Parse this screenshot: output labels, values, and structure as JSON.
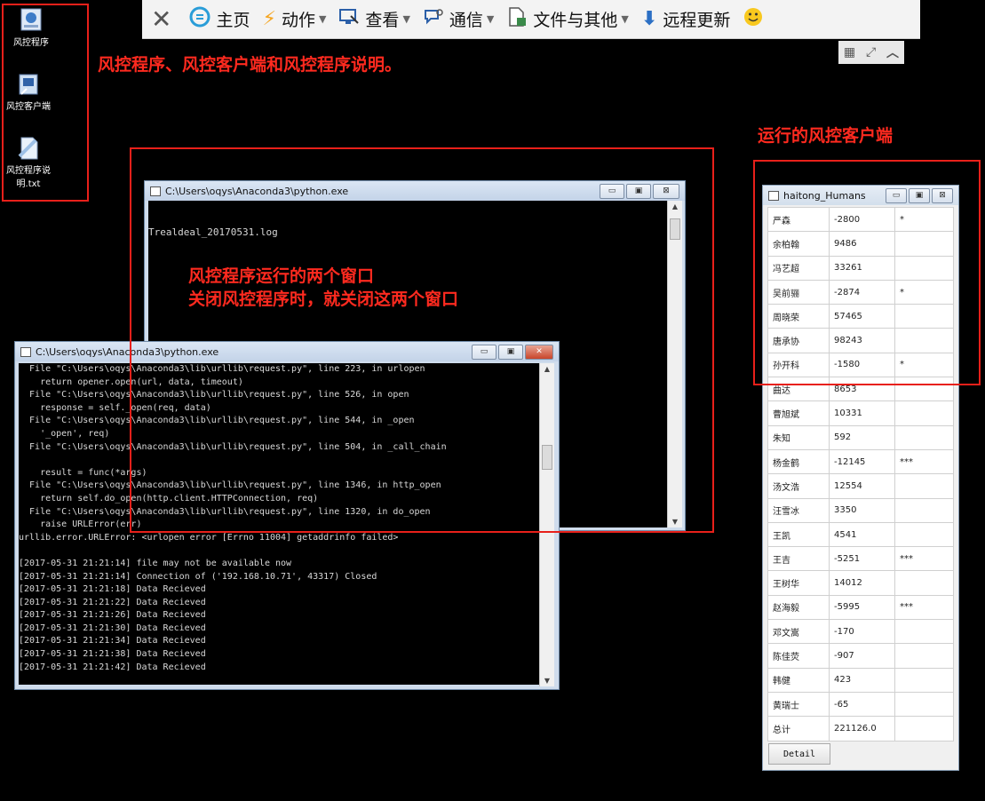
{
  "toolbar": {
    "items": [
      {
        "label": "",
        "icon": "close-icon"
      },
      {
        "label": "主页",
        "icon": "home-icon"
      },
      {
        "label": "动作",
        "icon": "lightning-icon",
        "dropdown": true
      },
      {
        "label": "查看",
        "icon": "monitor-icon",
        "dropdown": true
      },
      {
        "label": "通信",
        "icon": "chat-icon",
        "dropdown": true
      },
      {
        "label": "文件与其他",
        "icon": "file-icon",
        "dropdown": true
      },
      {
        "label": "远程更新",
        "icon": "download-icon"
      },
      {
        "label": "",
        "icon": "smiley-icon"
      }
    ]
  },
  "desktop": {
    "icons": [
      {
        "label": "风控程序",
        "icon": "program-icon"
      },
      {
        "label": "风控客户端",
        "icon": "shortcut-icon"
      },
      {
        "label": "风控程序说明.txt",
        "label_line1": "风控程序说",
        "label_line2": "明.txt",
        "icon": "text-file-icon"
      }
    ]
  },
  "annotations": {
    "desktop_note": "风控程序、风控客户端和风控程序说明。",
    "client_note": "运行的风控客户端",
    "windows_note_line1": "风控程序运行的两个窗口",
    "windows_note_line2": "关闭风控程序时，就关闭这两个窗口"
  },
  "window_back": {
    "title": "C:\\Users\\oqys\\Anaconda3\\python.exe",
    "lines": [
      "Trealdeal_20170531.log"
    ]
  },
  "window_front": {
    "title": "C:\\Users\\oqys\\Anaconda3\\python.exe",
    "text": "  File \"C:\\Users\\oqys\\Anaconda3\\lib\\urllib\\request.py\", line 223, in urlopen\n    return opener.open(url, data, timeout)\n  File \"C:\\Users\\oqys\\Anaconda3\\lib\\urllib\\request.py\", line 526, in open\n    response = self._open(req, data)\n  File \"C:\\Users\\oqys\\Anaconda3\\lib\\urllib\\request.py\", line 544, in _open\n    '_open', req)\n  File \"C:\\Users\\oqys\\Anaconda3\\lib\\urllib\\request.py\", line 504, in _call_chain\n\n    result = func(*args)\n  File \"C:\\Users\\oqys\\Anaconda3\\lib\\urllib\\request.py\", line 1346, in http_open\n    return self.do_open(http.client.HTTPConnection, req)\n  File \"C:\\Users\\oqys\\Anaconda3\\lib\\urllib\\request.py\", line 1320, in do_open\n    raise URLError(err)\nurllib.error.URLError: <urlopen error [Errno 11004] getaddrinfo failed>\n\n[2017-05-31 21:21:14] file may not be available now\n[2017-05-31 21:21:14] Connection of ('192.168.10.71', 43317) Closed\n[2017-05-31 21:21:18] Data Recieved\n[2017-05-31 21:21:22] Data Recieved\n[2017-05-31 21:21:26] Data Recieved\n[2017-05-31 21:21:30] Data Recieved\n[2017-05-31 21:21:34] Data Recieved\n[2017-05-31 21:21:38] Data Recieved\n[2017-05-31 21:21:42] Data Recieved"
  },
  "client": {
    "title": "haitong_Humans",
    "rows": [
      {
        "name": "严森",
        "value": "-2800",
        "flag": "*"
      },
      {
        "name": "余柏翰",
        "value": "9486",
        "flag": ""
      },
      {
        "name": "冯艺超",
        "value": "33261",
        "flag": ""
      },
      {
        "name": "吴前骊",
        "value": "-2874",
        "flag": "*"
      },
      {
        "name": "周晓荣",
        "value": "57465",
        "flag": ""
      },
      {
        "name": "唐承协",
        "value": "98243",
        "flag": ""
      },
      {
        "name": "孙开科",
        "value": "-1580",
        "flag": "*"
      },
      {
        "name": "曲达",
        "value": "8653",
        "flag": ""
      },
      {
        "name": "曹旭斌",
        "value": "10331",
        "flag": ""
      },
      {
        "name": "朱知",
        "value": "592",
        "flag": ""
      },
      {
        "name": "杨金鹤",
        "value": "-12145",
        "flag": "***"
      },
      {
        "name": "汤文浩",
        "value": "12554",
        "flag": ""
      },
      {
        "name": "汪雪冰",
        "value": "3350",
        "flag": ""
      },
      {
        "name": "王凯",
        "value": "4541",
        "flag": ""
      },
      {
        "name": "王吉",
        "value": "-5251",
        "flag": "***"
      },
      {
        "name": "王树华",
        "value": "14012",
        "flag": ""
      },
      {
        "name": "赵海毅",
        "value": "-5995",
        "flag": "***"
      },
      {
        "name": "邓文嵩",
        "value": "-170",
        "flag": ""
      },
      {
        "name": "陈佳荧",
        "value": "-907",
        "flag": ""
      },
      {
        "name": "韩健",
        "value": "423",
        "flag": ""
      },
      {
        "name": "黄瑞士",
        "value": "-65",
        "flag": ""
      },
      {
        "name": "总计",
        "value": "221126.0",
        "flag": ""
      }
    ],
    "detail_button": "Detail"
  },
  "colors": {
    "annotation": "#ff2a1f",
    "desktop": "#000000"
  }
}
